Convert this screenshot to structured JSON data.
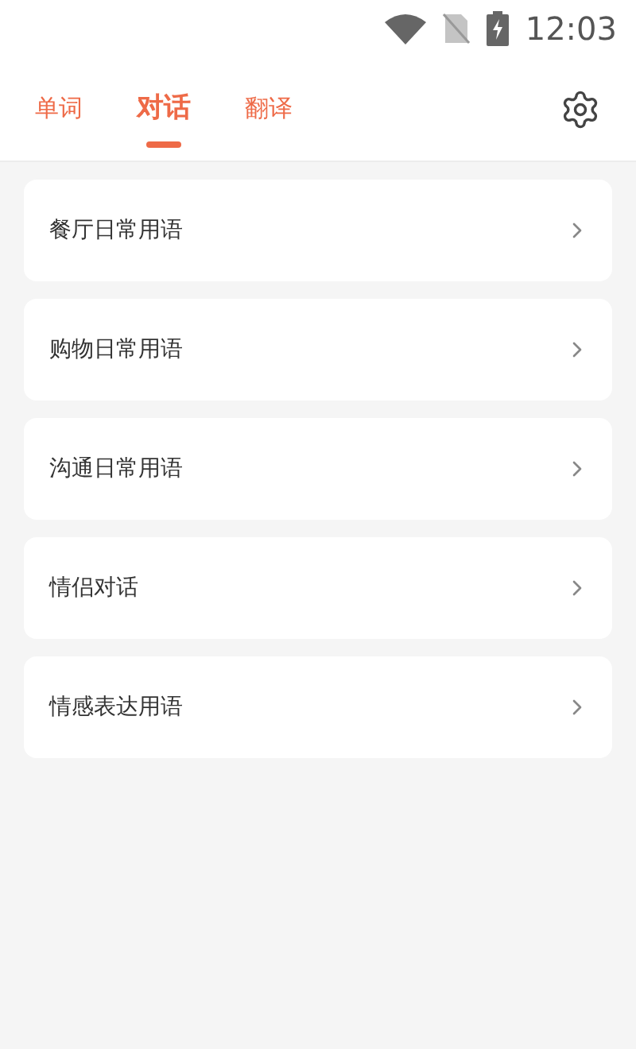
{
  "status_bar": {
    "time": "12:03"
  },
  "tabs": [
    {
      "label": "单词",
      "selected": false
    },
    {
      "label": "对话",
      "selected": true
    },
    {
      "label": "翻译",
      "selected": false
    }
  ],
  "topics": [
    {
      "title": "餐厅日常用语"
    },
    {
      "title": "购物日常用语"
    },
    {
      "title": "沟通日常用语"
    },
    {
      "title": "情侣对话"
    },
    {
      "title": "情感表达用语"
    }
  ]
}
